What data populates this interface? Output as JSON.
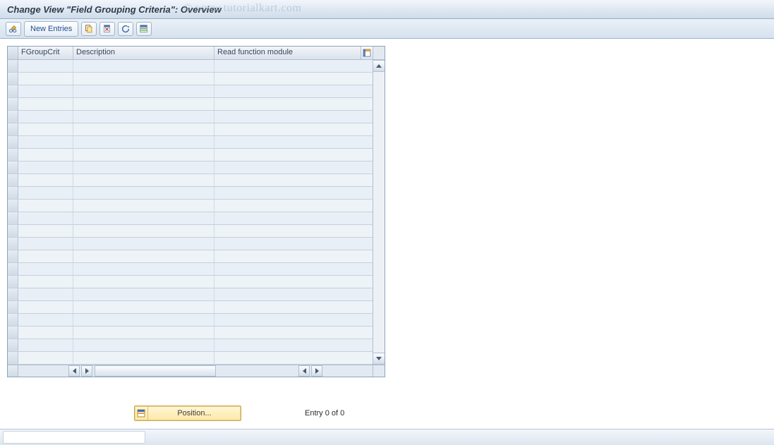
{
  "title": "Change View \"Field Grouping Criteria\": Overview",
  "watermark": "© www.tutorialkart.com",
  "toolbar": {
    "new_entries": "New Entries"
  },
  "table": {
    "columns": {
      "fgroupcrit": "FGroupCrit",
      "description": "Description",
      "read_fm": "Read function module"
    },
    "row_count": 24
  },
  "footer": {
    "position_label": "Position...",
    "entry_text": "Entry 0 of 0"
  }
}
